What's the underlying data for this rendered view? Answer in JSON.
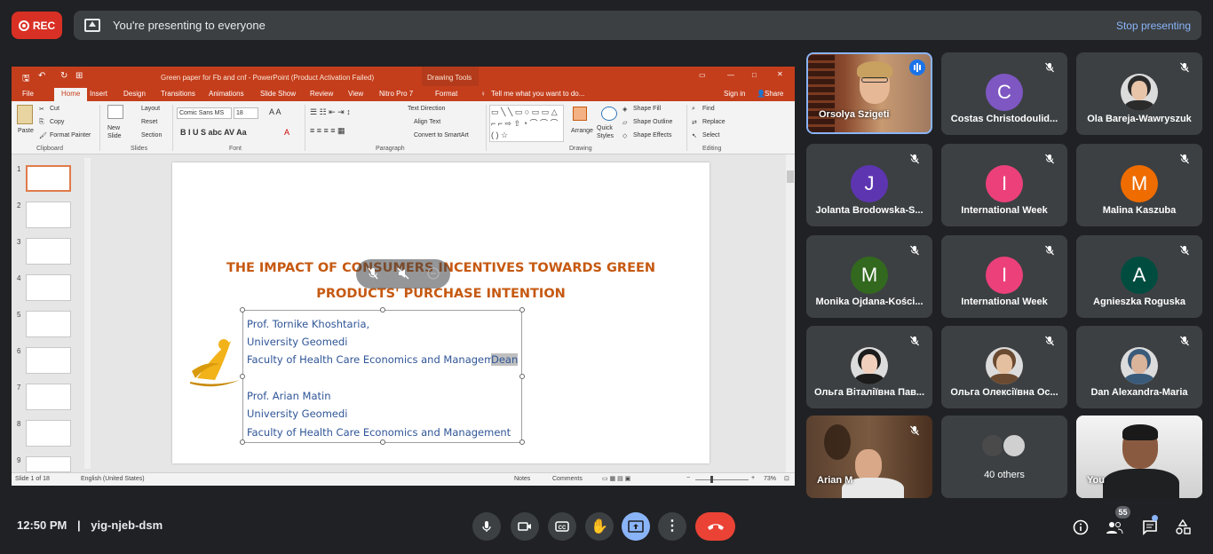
{
  "recording": {
    "label": "REC"
  },
  "presenting": {
    "message": "You're presenting to everyone",
    "stop_label": "Stop presenting"
  },
  "ppt": {
    "window_title": "Green paper for Fb and cnf - PowerPoint (Product Activation Failed)",
    "drawing_tools": "Drawing Tools",
    "tabs": [
      "File",
      "Home",
      "Insert",
      "Design",
      "Transitions",
      "Animations",
      "Slide Show",
      "Review",
      "View",
      "Nitro Pro 7",
      "Format"
    ],
    "tell_me": "Tell me what you want to do...",
    "sign_in": "Sign in",
    "share": "Share",
    "ribbon": {
      "paste": "Paste",
      "cut": "Cut",
      "copy": "Copy",
      "format_painter": "Format Painter",
      "new_slide": "New Slide",
      "layout": "Layout",
      "reset": "Reset",
      "section": "Section",
      "font_name": "Comic Sans MS",
      "font_size": "18",
      "text_direction": "Text Direction",
      "align_text": "Align Text",
      "convert_smartart": "Convert to SmartArt",
      "arrange": "Arrange",
      "quick_styles": "Quick Styles",
      "shape_fill": "Shape Fill",
      "shape_outline": "Shape Outline",
      "shape_effects": "Shape Effects",
      "find": "Find",
      "replace": "Replace",
      "select": "Select",
      "groups": [
        "Clipboard",
        "Slides",
        "Font",
        "Paragraph",
        "Drawing",
        "Editing"
      ]
    },
    "thumb_numbers": [
      "1",
      "2",
      "3",
      "4",
      "5",
      "6",
      "7",
      "8",
      "9"
    ],
    "slide": {
      "title_line1": "THE IMPACT OF CONSUMERS INCENTIVES TOWARDS GREEN",
      "title_line2": "PRODUCTS' PURCHASE INTENTION",
      "lines": [
        "Prof. Tornike Khoshtaria,",
        "University Geomedi",
        "Faculty of Health Care Economics and Management,",
        "Dean",
        "Prof. Arian Matin",
        "University Geomedi",
        "Faculty of Health Care Economics and Management"
      ]
    },
    "status": {
      "slide_of": "Slide 1 of 18",
      "language": "English (United States)",
      "notes": "Notes",
      "comments": "Comments",
      "zoom": "73%"
    }
  },
  "participants": [
    {
      "name": "Orsolya Szigeti",
      "initial": "",
      "color": "",
      "type": "video"
    },
    {
      "name": "Costas Christodoulid...",
      "initial": "C",
      "color": "#7e57c2",
      "type": "avatar"
    },
    {
      "name": "Ola Bareja-Wawryszuk",
      "initial": "",
      "color": "",
      "type": "photo"
    },
    {
      "name": "Jolanta Brodowska-S...",
      "initial": "J",
      "color": "#5e35b1",
      "type": "avatar"
    },
    {
      "name": "International Week",
      "initial": "I",
      "color": "#ec407a",
      "type": "avatar"
    },
    {
      "name": "Malina Kaszuba",
      "initial": "M",
      "color": "#ef6c00",
      "type": "avatar"
    },
    {
      "name": "Monika Ojdana-Kości...",
      "initial": "M",
      "color": "#33691e",
      "type": "avatar"
    },
    {
      "name": "International Week",
      "initial": "I",
      "color": "#ec407a",
      "type": "avatar"
    },
    {
      "name": "Agnieszka Roguska",
      "initial": "A",
      "color": "#004d40",
      "type": "avatar"
    },
    {
      "name": "Ольга Віталіївна Пав...",
      "initial": "",
      "color": "",
      "type": "photo"
    },
    {
      "name": "Ольга Олексіївна Ос...",
      "initial": "",
      "color": "",
      "type": "photo"
    },
    {
      "name": "Dan Alexandra-Maria",
      "initial": "",
      "color": "",
      "type": "photo"
    },
    {
      "name": "Arian M",
      "initial": "",
      "color": "",
      "type": "video"
    },
    {
      "name": "40 others",
      "initial": "",
      "color": "",
      "type": "others"
    },
    {
      "name": "You",
      "initial": "",
      "color": "",
      "type": "video"
    }
  ],
  "bottom": {
    "time": "12:50 PM",
    "separator": "|",
    "meeting_code": "yig-njeb-dsm",
    "people_count": "55"
  },
  "colors": {
    "accent": "#8ab4f8",
    "end_call": "#ea4335",
    "present_active": "#8ab4f8",
    "ppt_orange": "#c43e1c"
  }
}
